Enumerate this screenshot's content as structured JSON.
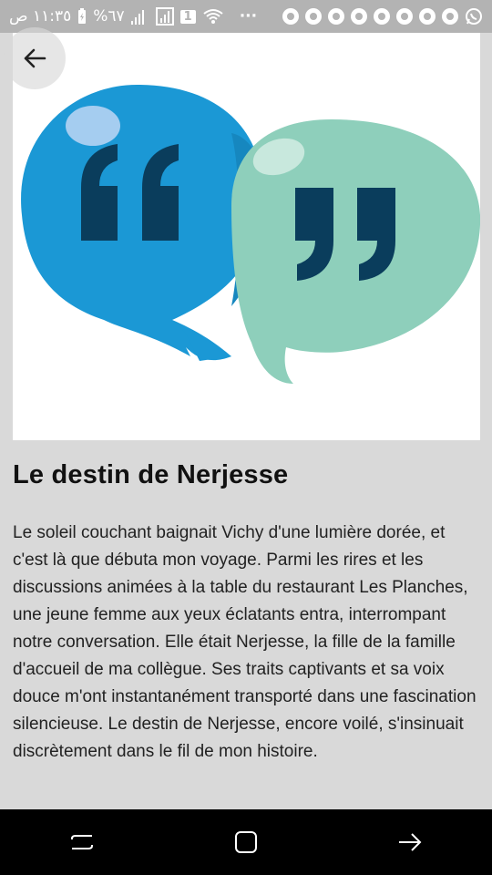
{
  "status_bar": {
    "time": "١١:٣٥ ص",
    "battery": "%٦٧",
    "sim_badge": "1",
    "dots": "···",
    "icons": [
      "signal-icon",
      "battery-icon",
      "wifi-icon",
      "chrome-icon",
      "whatsapp-icon"
    ]
  },
  "header": {
    "back_icon": "arrow-left-icon"
  },
  "hero_image": {
    "description_icon": "quote-bubbles",
    "colors": {
      "blue": "#1b98d5",
      "green": "#8ecfbb",
      "dark": "#0a3d5c"
    }
  },
  "article": {
    "title": "Le destin de Nerjesse",
    "body": "Le soleil couchant baignait Vichy d'une lumière dorée, et c'est là que débuta mon voyage. Parmi les rires et les discussions animées à la table du restaurant Les Planches, une jeune femme aux yeux éclatants entra, interrompant notre conversation. Elle était Nerjesse, la fille de la famille d'accueil de ma collègue. Ses traits captivants et sa voix douce m'ont instantanément transporté dans une fascination silencieuse. Le destin de Nerjesse, encore voilé, s'insinuait discrètement dans le fil de mon histoire."
  },
  "nav_bar": {
    "buttons": [
      "recents-icon",
      "home-icon",
      "back-nav-icon"
    ]
  }
}
